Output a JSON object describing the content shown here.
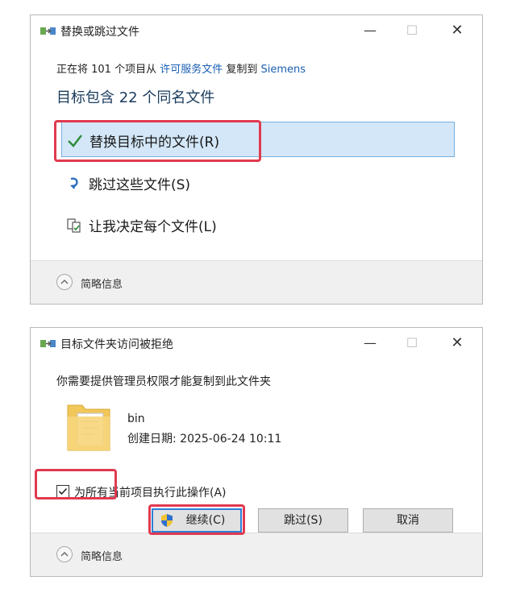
{
  "dialog1": {
    "title": "替换或跳过文件",
    "copy_prefix": "正在将 101 个项目从",
    "copy_source": "许可服务文件",
    "copy_middle": "复制到",
    "copy_destination": "Siemens",
    "heading": "目标包含 22 个同名文件",
    "options": [
      {
        "label": "替换目标中的文件(R)",
        "icon": "checkmark-icon",
        "selected": true
      },
      {
        "label": "跳过这些文件(S)",
        "icon": "skip-arrow-icon",
        "selected": false
      },
      {
        "label": "让我决定每个文件(L)",
        "icon": "compare-files-icon",
        "selected": false
      }
    ],
    "details_label": "简略信息"
  },
  "dialog2": {
    "title": "目标文件夹访问被拒绝",
    "message": "你需要提供管理员权限才能复制到此文件夹",
    "folder_name": "bin",
    "created_date": "创建日期: 2025-06-24 10:11",
    "apply_all_label": "为所有当前项目执行此操作(A)",
    "apply_all_checked": true,
    "buttons": {
      "continue": "继续(C)",
      "skip": "跳过(S)",
      "cancel": "取消"
    },
    "details_label": "简略信息"
  },
  "window_controls": {
    "minimize": "—",
    "maximize": "☐",
    "close": "✕"
  },
  "colors": {
    "annotation": "#e03a4f",
    "selection_fill": "#d3e7f8",
    "selection_border": "#76aee0",
    "link": "#1a5fb4",
    "check": "#2e8b3a"
  }
}
